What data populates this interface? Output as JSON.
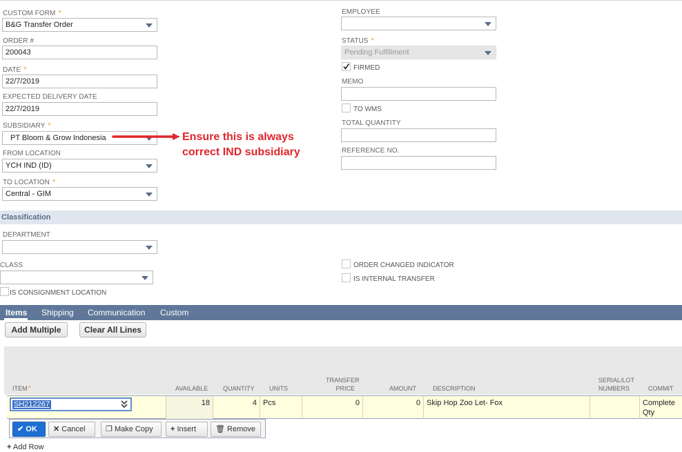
{
  "form": {
    "custom_form": {
      "label": "CUSTOM FORM",
      "value": "B&G Transfer Order"
    },
    "order_no": {
      "label": "ORDER #",
      "value": "200043"
    },
    "date": {
      "label": "DATE",
      "value": "22/7/2019"
    },
    "expected_delivery": {
      "label": "EXPECTED DELIVERY DATE",
      "value": "22/7/2019"
    },
    "subsidiary": {
      "label": "SUBSIDIARY",
      "value": "PT Bloom & Grow Indonesia"
    },
    "from_location": {
      "label": "FROM LOCATION",
      "value": "YCH IND (ID)"
    },
    "to_location": {
      "label": "TO LOCATION",
      "value": "Central - GIM"
    },
    "employee": {
      "label": "EMPLOYEE",
      "value": ""
    },
    "status": {
      "label": "STATUS",
      "value": "Pending Fulfillment"
    },
    "firmed": {
      "label": "FIRMED",
      "checked": true
    },
    "memo": {
      "label": "MEMO",
      "value": ""
    },
    "to_wms": {
      "label": "TO WMS",
      "checked": false
    },
    "total_quantity": {
      "label": "TOTAL QUANTITY",
      "value": ""
    },
    "reference_no": {
      "label": "REFERENCE NO.",
      "value": ""
    },
    "required_mark": "*"
  },
  "annotation": {
    "line1": "Ensure this is always",
    "line2": "correct IND subsidiary",
    "color": "#e0262c"
  },
  "classification": {
    "title": "Classification",
    "department": {
      "label": "DEPARTMENT",
      "value": ""
    },
    "class": {
      "label": "CLASS",
      "value": ""
    },
    "order_changed": {
      "label": "ORDER CHANGED INDICATOR",
      "checked": false
    },
    "internal_transfer": {
      "label": "IS INTERNAL TRANSFER",
      "checked": false
    },
    "consignment": {
      "label": "IS CONSIGNMENT LOCATION",
      "checked": false
    }
  },
  "tabs": [
    "Items",
    "Shipping",
    "Communication",
    "Custom"
  ],
  "buttons": {
    "add_multiple": "Add Multiple",
    "clear_all": "Clear All Lines"
  },
  "grid": {
    "columns": {
      "item": "ITEM",
      "available": "AVAILABLE",
      "quantity": "QUANTITY",
      "units": "UNITS",
      "transfer_price_1": "TRANSFER",
      "transfer_price_2": "PRICE",
      "amount": "AMOUNT",
      "description": "DESCRIPTION",
      "serial_1": "SERIAL/LOT",
      "serial_2": "NUMBERS",
      "commit": "COMMIT"
    },
    "row": {
      "item": "SH212267",
      "available": "18",
      "quantity": "4",
      "units": "Pcs",
      "transfer_price": "0",
      "amount": "0",
      "description": "Skip Hop Zoo Let- Fox",
      "serial": "",
      "commit_1": "Complete",
      "commit_2": "Qty"
    }
  },
  "row_actions": {
    "ok": "OK",
    "cancel": "Cancel",
    "make_copy": "Make Copy",
    "insert": "Insert",
    "remove": "Remove"
  },
  "add_row": "Add Row",
  "colors": {
    "accent": "#607799",
    "section": "#e0e6ef",
    "ok_button": "#1d6fd1",
    "row_highlight": "#ffffe0"
  }
}
